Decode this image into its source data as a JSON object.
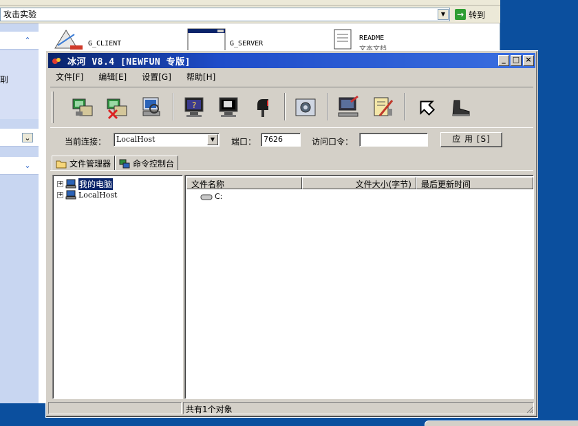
{
  "explorer": {
    "address": "攻击实验",
    "go_label": "转到",
    "task_fragment": "刵",
    "files": [
      {
        "name": "G_CLIENT"
      },
      {
        "name": "G_SERVER"
      },
      {
        "name": "README",
        "sub": "文本文档"
      }
    ]
  },
  "app": {
    "title": "冰河 V8.4 [NEWFUN 专版]",
    "menu": [
      "文件[F]",
      "编辑[E]",
      "设置[G]",
      "帮助[H]"
    ],
    "connection": {
      "label": "当前连接：",
      "value": "LocalHost",
      "port_label": "端口：",
      "port_value": "7626",
      "password_label": "访问口令：",
      "password_value": "",
      "apply_label": "应 用 [S]"
    },
    "tabs": [
      "文件管理器",
      "命令控制台"
    ],
    "tree": [
      {
        "label": "我的电脑",
        "selected": true
      },
      {
        "label": "LocalHost",
        "selected": false
      }
    ],
    "columns": [
      "文件名称",
      "文件大小(字节)",
      "最后更新时间"
    ],
    "rows": [
      {
        "name": "C:"
      }
    ],
    "status": "共有1个对象"
  },
  "colors": {
    "desktop": "#0b4f9e",
    "titlebar_start": "#0a246a",
    "titlebar_end": "#3a6fe0",
    "selection": "#0a246a",
    "face": "#d4d0c8"
  }
}
